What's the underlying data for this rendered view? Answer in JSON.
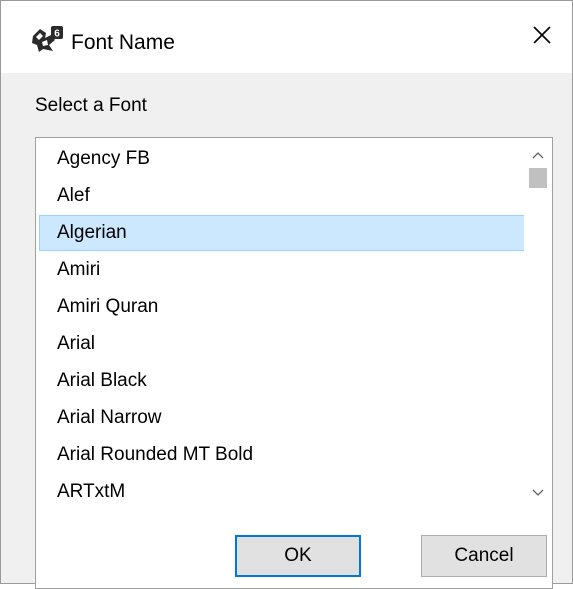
{
  "window": {
    "title": "Font Name",
    "icon": "app-logo-icon",
    "close": "close-icon"
  },
  "section_label": "Select a Font",
  "font_list": {
    "items": [
      "Agency FB",
      "Alef",
      "Algerian",
      "Amiri",
      "Amiri Quran",
      "Arial",
      "Arial Black",
      "Arial Narrow",
      "Arial Rounded MT Bold",
      "ARTxtM"
    ],
    "selected": "Algerian"
  },
  "buttons": {
    "ok": "OK",
    "cancel": "Cancel"
  },
  "colors": {
    "selection_bg": "#cce8ff",
    "selection_border": "#99d1ff",
    "default_button_border": "#0078d7"
  }
}
